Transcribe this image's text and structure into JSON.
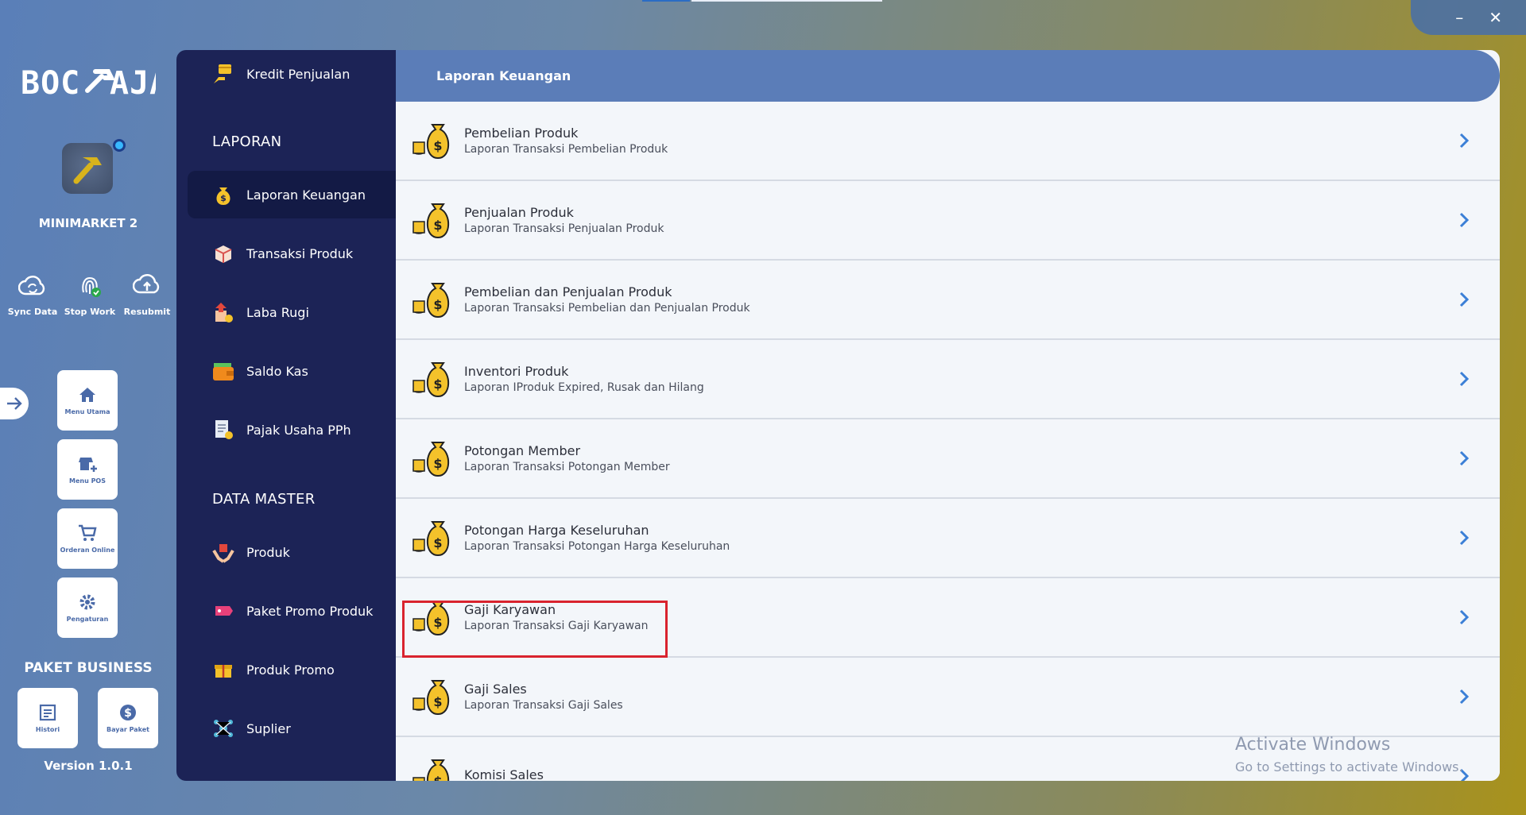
{
  "app": {
    "logo_text": "BOC AJA",
    "store_name": "MINIMARKET 2",
    "plan": "PAKET BUSINESS",
    "version": "Version 1.0.1"
  },
  "quick_actions": [
    {
      "label": "Sync Data",
      "icon": "cloud-sync-icon"
    },
    {
      "label": "Stop Work",
      "icon": "fingerprint-check-icon"
    },
    {
      "label": "Resubmit",
      "icon": "cloud-upload-icon"
    }
  ],
  "tiles": {
    "home": "Menu Utama",
    "pos": "Menu POS",
    "online": "Orderan Online",
    "settings": "Pengaturan",
    "history": "Histori",
    "pay": "Bayar Paket"
  },
  "sidebar": {
    "top_item": "Kredit Penjualan",
    "section_reports": "LAPORAN",
    "reports": [
      "Laporan Keuangan",
      "Transaksi Produk",
      "Laba Rugi",
      "Saldo Kas",
      "Pajak Usaha PPh"
    ],
    "section_master": "DATA MASTER",
    "master": [
      "Produk",
      "Paket Promo Produk",
      "Produk Promo",
      "Suplier"
    ]
  },
  "main": {
    "header": "Laporan Keuangan",
    "rows": [
      {
        "title": "Pembelian Produk",
        "subtitle": "Laporan Transaksi Pembelian Produk"
      },
      {
        "title": "Penjualan Produk",
        "subtitle": "Laporan Transaksi Penjualan Produk"
      },
      {
        "title": "Pembelian dan Penjualan Produk",
        "subtitle": "Laporan Transaksi Pembelian dan Penjualan Produk"
      },
      {
        "title": "Inventori Produk",
        "subtitle": "Laporan IProduk Expired, Rusak dan Hilang"
      },
      {
        "title": "Potongan Member",
        "subtitle": "Laporan Transaksi Potongan Member"
      },
      {
        "title": "Potongan Harga Keseluruhan",
        "subtitle": "Laporan Transaksi Potongan Harga Keseluruhan"
      },
      {
        "title": "Gaji Karyawan",
        "subtitle": "Laporan Transaksi Gaji Karyawan"
      },
      {
        "title": "Gaji Sales",
        "subtitle": "Laporan Transaksi Gaji Sales"
      },
      {
        "title": "Komisi Sales",
        "subtitle": ""
      }
    ]
  },
  "watermark": {
    "line1": "Activate Windows",
    "line2": "Go to Settings to activate Windows."
  },
  "colors": {
    "sidebar_bg": "#1c2356",
    "header_bg": "#5b7db8",
    "accent": "#2b6cc4",
    "highlight_border": "#d9232e"
  }
}
